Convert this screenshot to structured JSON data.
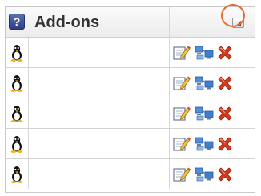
{
  "header": {
    "help_icon_glyph": "?",
    "title": "Add-ons",
    "collapse_glyph": "◢"
  },
  "rows": [
    {
      "os_icon": "linux-penguin-icon",
      "actions": [
        "edit-icon",
        "network-icon",
        "delete-icon"
      ]
    },
    {
      "os_icon": "linux-penguin-icon",
      "actions": [
        "edit-icon",
        "network-icon",
        "delete-icon"
      ]
    },
    {
      "os_icon": "linux-penguin-icon",
      "actions": [
        "edit-icon",
        "network-icon",
        "delete-icon"
      ]
    },
    {
      "os_icon": "linux-penguin-icon",
      "actions": [
        "edit-icon",
        "network-icon",
        "delete-icon"
      ]
    },
    {
      "os_icon": "linux-penguin-icon",
      "actions": [
        "edit-icon",
        "network-icon",
        "delete-icon"
      ]
    }
  ],
  "colors": {
    "highlight": "#e8692b",
    "help_badge": "#3b4a95",
    "delete": "#d9391b"
  }
}
